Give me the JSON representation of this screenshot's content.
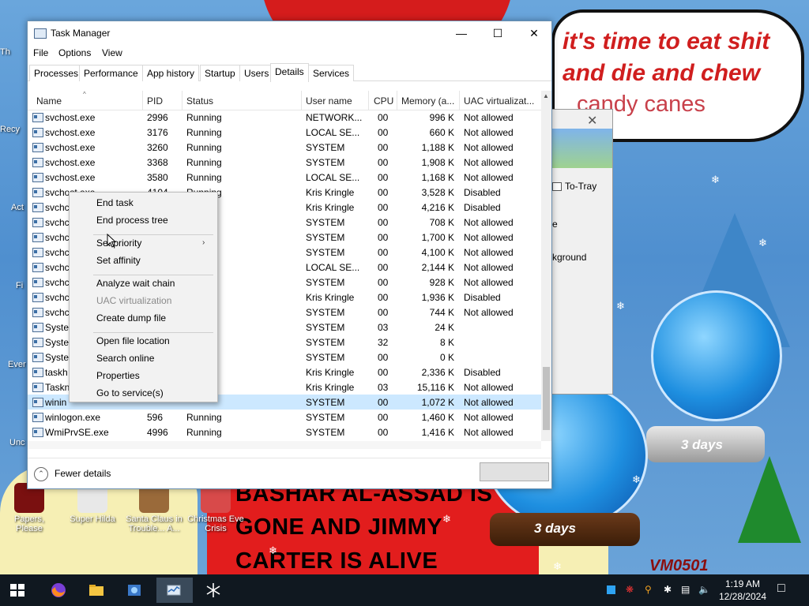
{
  "desktop": {
    "speech_bubble": [
      "it's time to eat shit",
      "and die and chew",
      "candy canes"
    ],
    "banner": [
      "BASHAR AL-ASSAD IS",
      "GONE AND JIMMY",
      "CARTER IS ALIVE"
    ],
    "globe_small_label": "3 days",
    "globe_large_label": "3 days",
    "watermark": "VM0501",
    "icons": [
      {
        "label": "Papers, Please"
      },
      {
        "label": "Super Hilda"
      },
      {
        "label": "Santa Claus in Trouble... A..."
      },
      {
        "label": "Christmas Eve Crisis"
      }
    ],
    "cut_labels": [
      "Th",
      "Recy",
      "Act",
      "Fi",
      "Ever",
      "Unc"
    ]
  },
  "background_window": {
    "to_tray": "To-Tray",
    "text_e": "e",
    "text_kg": "kground"
  },
  "taskmanager": {
    "title": "Task Manager",
    "menu": [
      "File",
      "Options",
      "View"
    ],
    "tabs": [
      "Processes",
      "Performance",
      "App history",
      "Startup",
      "Users",
      "Details",
      "Services"
    ],
    "active_tab": "Details",
    "columns": [
      "Name",
      "PID",
      "Status",
      "User name",
      "CPU",
      "Memory (a...",
      "UAC virtualizat..."
    ],
    "rows": [
      {
        "name": "svchost.exe",
        "pid": "2996",
        "status": "Running",
        "user": "NETWORK...",
        "cpu": "00",
        "mem": "996 K",
        "uac": "Not allowed"
      },
      {
        "name": "svchost.exe",
        "pid": "3176",
        "status": "Running",
        "user": "LOCAL SE...",
        "cpu": "00",
        "mem": "660 K",
        "uac": "Not allowed"
      },
      {
        "name": "svchost.exe",
        "pid": "3260",
        "status": "Running",
        "user": "SYSTEM",
        "cpu": "00",
        "mem": "1,188 K",
        "uac": "Not allowed"
      },
      {
        "name": "svchost.exe",
        "pid": "3368",
        "status": "Running",
        "user": "SYSTEM",
        "cpu": "00",
        "mem": "1,908 K",
        "uac": "Not allowed"
      },
      {
        "name": "svchost.exe",
        "pid": "3580",
        "status": "Running",
        "user": "LOCAL SE...",
        "cpu": "00",
        "mem": "1,168 K",
        "uac": "Not allowed"
      },
      {
        "name": "svchost.exe",
        "pid": "4104",
        "status": "Running",
        "user": "Kris Kringle",
        "cpu": "00",
        "mem": "3,528 K",
        "uac": "Disabled"
      },
      {
        "name": "svchc",
        "pid": "",
        "status": "",
        "user": "Kris Kringle",
        "cpu": "00",
        "mem": "4,216 K",
        "uac": "Disabled"
      },
      {
        "name": "svchc",
        "pid": "",
        "status": "",
        "user": "SYSTEM",
        "cpu": "00",
        "mem": "708 K",
        "uac": "Not allowed"
      },
      {
        "name": "svchc",
        "pid": "",
        "status": "",
        "user": "SYSTEM",
        "cpu": "00",
        "mem": "1,700 K",
        "uac": "Not allowed"
      },
      {
        "name": "svchc",
        "pid": "",
        "status": "",
        "user": "SYSTEM",
        "cpu": "00",
        "mem": "4,100 K",
        "uac": "Not allowed"
      },
      {
        "name": "svchc",
        "pid": "",
        "status": "",
        "user": "LOCAL SE...",
        "cpu": "00",
        "mem": "2,144 K",
        "uac": "Not allowed"
      },
      {
        "name": "svchc",
        "pid": "",
        "status": "",
        "user": "SYSTEM",
        "cpu": "00",
        "mem": "928 K",
        "uac": "Not allowed"
      },
      {
        "name": "svchc",
        "pid": "",
        "status": "",
        "user": "Kris Kringle",
        "cpu": "00",
        "mem": "1,936 K",
        "uac": "Disabled"
      },
      {
        "name": "svchc",
        "pid": "",
        "status": "",
        "user": "SYSTEM",
        "cpu": "00",
        "mem": "744 K",
        "uac": "Not allowed"
      },
      {
        "name": "Syster",
        "pid": "",
        "status": "",
        "user": "SYSTEM",
        "cpu": "03",
        "mem": "24 K",
        "uac": ""
      },
      {
        "name": "Syster",
        "pid": "",
        "status": "",
        "user": "SYSTEM",
        "cpu": "32",
        "mem": "8 K",
        "uac": ""
      },
      {
        "name": "Syster",
        "pid": "",
        "status": "",
        "user": "SYSTEM",
        "cpu": "00",
        "mem": "0 K",
        "uac": ""
      },
      {
        "name": "taskh",
        "pid": "",
        "status": "",
        "user": "Kris Kringle",
        "cpu": "00",
        "mem": "2,336 K",
        "uac": "Disabled"
      },
      {
        "name": "Taskn",
        "pid": "",
        "status": "",
        "user": "Kris Kringle",
        "cpu": "03",
        "mem": "15,116 K",
        "uac": "Not allowed"
      },
      {
        "name": "winin",
        "pid": "",
        "status": "",
        "user": "SYSTEM",
        "cpu": "00",
        "mem": "1,072 K",
        "uac": "Not allowed",
        "selected": true
      },
      {
        "name": "winlogon.exe",
        "pid": "596",
        "status": "Running",
        "user": "SYSTEM",
        "cpu": "00",
        "mem": "1,460 K",
        "uac": "Not allowed"
      },
      {
        "name": "WmiPrvSE.exe",
        "pid": "4996",
        "status": "Running",
        "user": "SYSTEM",
        "cpu": "00",
        "mem": "1,416 K",
        "uac": "Not allowed"
      }
    ],
    "footer_label": "Fewer details"
  },
  "context_menu": {
    "items": [
      {
        "label": "End task",
        "enabled": true
      },
      {
        "label": "End process tree",
        "enabled": true
      },
      {
        "sep": true
      },
      {
        "label": "Set priority",
        "enabled": true,
        "submenu": true
      },
      {
        "label": "Set affinity",
        "enabled": true
      },
      {
        "sep": true
      },
      {
        "label": "Analyze wait chain",
        "enabled": true
      },
      {
        "label": "UAC virtualization",
        "enabled": false
      },
      {
        "label": "Create dump file",
        "enabled": true
      },
      {
        "sep": true
      },
      {
        "label": "Open file location",
        "enabled": true
      },
      {
        "label": "Search online",
        "enabled": true
      },
      {
        "label": "Properties",
        "enabled": true
      },
      {
        "label": "Go to service(s)",
        "enabled": true
      }
    ]
  },
  "taskbar": {
    "apps": [
      "start-icon",
      "firefox-icon",
      "file-explorer-icon",
      "app-icon",
      "task-manager-icon",
      "snowflake-app-icon"
    ],
    "clock_time": "1:19 AM",
    "clock_date": "12/28/2024"
  },
  "colors": {
    "selected_row": "#cce8ff",
    "menu_bg": "#f2f2f2",
    "taskbar": "#101820"
  }
}
